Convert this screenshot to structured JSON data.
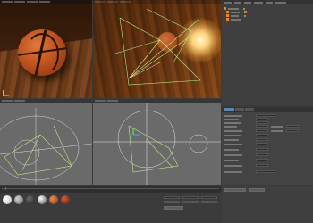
{
  "app": {
    "accent_color": "#e8861c",
    "timeline_marker_color": "#d04040"
  },
  "object_manager": {
    "objects": [
      {
        "icon": "null-object-icon",
        "color": "#e8861c"
      },
      {
        "icon": "camera-icon",
        "color": "#e8861c"
      },
      {
        "icon": "light-icon",
        "color": "#e8861c"
      },
      {
        "icon": "sphere-icon",
        "color": "#e8861c"
      }
    ]
  },
  "materials": [
    {
      "name": "white-material",
      "color": "#f0f0f0"
    },
    {
      "name": "gray-material",
      "color": "#9a9a9a"
    },
    {
      "name": "dark-material",
      "color": "#3a3a3a"
    },
    {
      "name": "chrome-material",
      "color": "#bdbdbd"
    },
    {
      "name": "basketball-material",
      "color": "#c25a28"
    },
    {
      "name": "red-material",
      "color": "#a8341f"
    }
  ]
}
